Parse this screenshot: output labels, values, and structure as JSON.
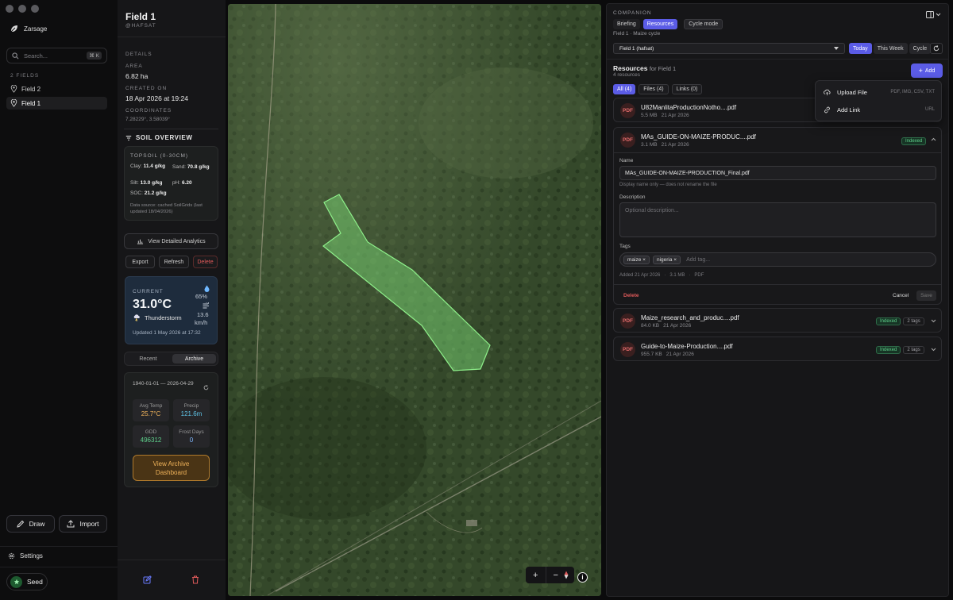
{
  "sidebar": {
    "app_name": "Zarsage",
    "search_placeholder": "Search...",
    "search_shortcut": "⌘ K",
    "fields_label": "2 FIELDS",
    "fields": [
      {
        "label": "Field 2"
      },
      {
        "label": "Field 1"
      }
    ],
    "draw_label": "Draw",
    "import_label": "Import",
    "settings_label": "Settings",
    "seed_label": "Seed"
  },
  "details": {
    "title": "Field 1",
    "handle": "@HAFSAT",
    "details_label": "DETAILS",
    "area_label": "AREA",
    "area_value": "6.82 ha",
    "created_label": "CREATED ON",
    "created_value": "18 Apr 2026 at 19:24",
    "coords_label": "COORDINATES",
    "coords_value": "7.28229°, 3.58039°",
    "soil_title": "SOIL OVERVIEW",
    "topsoil_label": "TOPSOIL (0-30CM)",
    "clay_label": "Clay:",
    "clay_value": "11.4 g/kg",
    "sand_label": "Sand:",
    "sand_value": "70.8 g/kg",
    "silt_label": "Silt:",
    "silt_value": "13.0 g/kg",
    "ph_label": "pH:",
    "ph_value": "6.20",
    "soc_label": "SOC:",
    "soc_value": "21.2 g/kg",
    "soil_source": "Data source: cached SoilGrids (last updated 18/04/2026)",
    "analytics_label": "View Detailed Analytics",
    "export_label": "Export",
    "refresh_label": "Refresh",
    "delete_label": "Delete",
    "weather": {
      "current_label": "CURRENT",
      "temp": "31.0°C",
      "condition": "Thunderstorm",
      "humidity": "65%",
      "wind_value": "13.6",
      "wind_unit": "km/h",
      "updated": "Updated 1 May 2026 at 17:32"
    },
    "tabs": [
      "Recent",
      "Archive"
    ],
    "archive": {
      "range": "1940-01-01 — 2026-04-29",
      "avg_temp_label": "Avg Temp",
      "avg_temp_value": "25.7°C",
      "precip_label": "Precip",
      "precip_value": "121.6m",
      "gdd_label": "GDD",
      "gdd_value": "496312",
      "frost_label": "Frost Days",
      "frost_value": "0",
      "dashboard_label": "View Archive Dashboard"
    }
  },
  "panel": {
    "companion_label": "COMPANION",
    "tabs": [
      "Briefing",
      "Resources",
      "Cycle mode"
    ],
    "cycle_subtitle": "Field 1 · Maize cycle",
    "field_select": "Field 1 (hafsat)",
    "period_tabs": [
      "Today",
      "This Week",
      "Cycle"
    ],
    "resources_title": "Resources",
    "resources_for": "for Field 1",
    "resources_count": "4 resources",
    "add_label": "Add",
    "filter_tabs": [
      "All (4)",
      "Files (4)",
      "Links (0)"
    ],
    "add_menu": {
      "upload_label": "Upload File",
      "upload_hint": "PDF, IMG, CSV, TXT",
      "link_label": "Add Link",
      "link_hint": "URL"
    },
    "resources": [
      {
        "icon": "PDF",
        "name": "U82ManlitaProductionNotho....pdf",
        "size": "5.5 MB",
        "date": "21 Apr 2026",
        "status": "",
        "tags": ""
      },
      {
        "icon": "PDF",
        "name": "MAs_GUIDE-ON-MAIZE-PRODUC....pdf",
        "size": "3.1 MB",
        "date": "21 Apr 2026",
        "status": "Indexed",
        "tags": ""
      },
      {
        "icon": "PDF",
        "name": "Maize_research_and_produc....pdf",
        "size": "84.0 KB",
        "date": "21 Apr 2026",
        "status": "Indexed",
        "tags": "2 tags"
      },
      {
        "icon": "PDF",
        "name": "Guide-to-Maize-Production....pdf",
        "size": "955.7 KB",
        "date": "21 Apr 2026",
        "status": "Indexed",
        "tags": "2 tags"
      }
    ],
    "editor": {
      "name_label": "Name",
      "name_value": "MAs_GUIDE-ON-MAIZE-PRODUCTION_Final.pdf",
      "name_hint": "Display name only — does not rename the file",
      "desc_label": "Description",
      "desc_placeholder": "Optional description...",
      "tags_label": "Tags",
      "tags": [
        "maize",
        "nigeria"
      ],
      "tag_placeholder": "Add tag...",
      "meta_added": "Added 21 Apr 2026",
      "meta_size": "3.1 MB",
      "meta_type": "PDF",
      "delete_label": "Delete",
      "cancel_label": "Cancel",
      "save_label": "Save"
    }
  },
  "colors": {
    "accent": "#5b5ce6",
    "danger": "#e05a5a",
    "indexed": "#5fd18c",
    "field_polygon": "#7ee27a",
    "archive_button": "#f0b35a"
  }
}
